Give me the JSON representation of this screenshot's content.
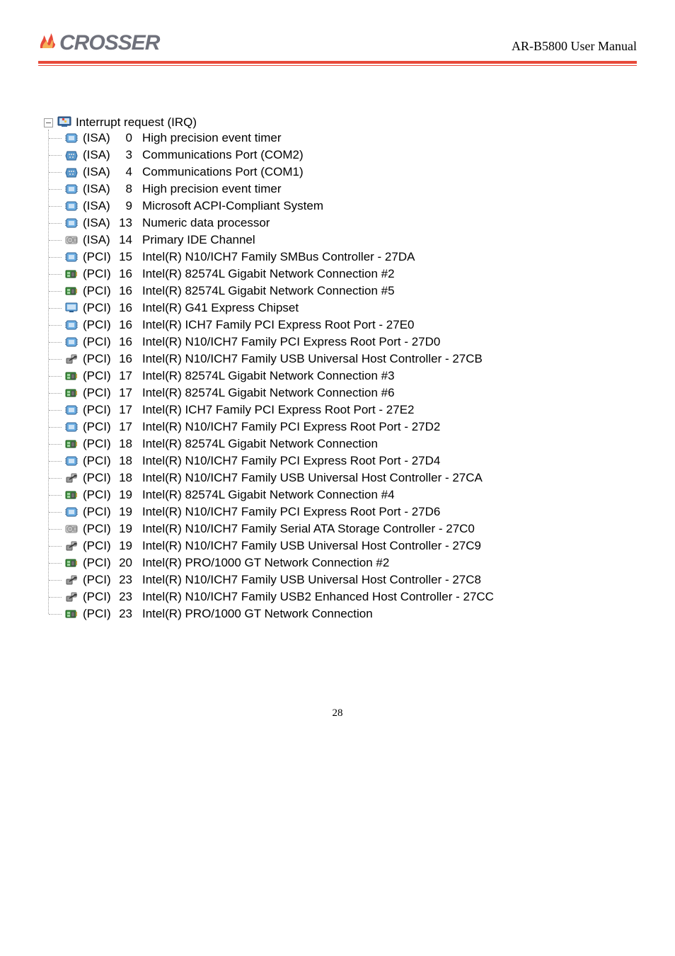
{
  "header": {
    "logo_main": "CROSSER",
    "doc_title": "AR-B5800 User Manual"
  },
  "tree": {
    "root_label": "Interrupt request (IRQ)",
    "items": [
      {
        "icon": "chip",
        "bus": "(ISA)",
        "irq": "0",
        "desc": "High precision event timer"
      },
      {
        "icon": "port",
        "bus": "(ISA)",
        "irq": "3",
        "desc": "Communications Port (COM2)"
      },
      {
        "icon": "port",
        "bus": "(ISA)",
        "irq": "4",
        "desc": "Communications Port (COM1)"
      },
      {
        "icon": "chip",
        "bus": "(ISA)",
        "irq": "8",
        "desc": "High precision event timer"
      },
      {
        "icon": "chip",
        "bus": "(ISA)",
        "irq": "9",
        "desc": "Microsoft ACPI-Compliant System"
      },
      {
        "icon": "chip",
        "bus": "(ISA)",
        "irq": "13",
        "desc": "Numeric data processor"
      },
      {
        "icon": "disk",
        "bus": "(ISA)",
        "irq": "14",
        "desc": "Primary IDE Channel"
      },
      {
        "icon": "chip",
        "bus": "(PCI)",
        "irq": "15",
        "desc": "Intel(R) N10/ICH7 Family SMBus Controller - 27DA"
      },
      {
        "icon": "nic",
        "bus": "(PCI)",
        "irq": "16",
        "desc": "Intel(R) 82574L Gigabit Network Connection #2"
      },
      {
        "icon": "nic",
        "bus": "(PCI)",
        "irq": "16",
        "desc": "Intel(R) 82574L Gigabit Network Connection #5"
      },
      {
        "icon": "display",
        "bus": "(PCI)",
        "irq": "16",
        "desc": "Intel(R) G41 Express Chipset"
      },
      {
        "icon": "chip",
        "bus": "(PCI)",
        "irq": "16",
        "desc": "Intel(R) ICH7 Family PCI Express Root Port - 27E0"
      },
      {
        "icon": "chip",
        "bus": "(PCI)",
        "irq": "16",
        "desc": "Intel(R) N10/ICH7 Family PCI Express Root Port - 27D0"
      },
      {
        "icon": "usb",
        "bus": "(PCI)",
        "irq": "16",
        "desc": "Intel(R) N10/ICH7 Family USB Universal Host Controller - 27CB"
      },
      {
        "icon": "nic",
        "bus": "(PCI)",
        "irq": "17",
        "desc": "Intel(R) 82574L Gigabit Network Connection #3"
      },
      {
        "icon": "nic",
        "bus": "(PCI)",
        "irq": "17",
        "desc": "Intel(R) 82574L Gigabit Network Connection #6"
      },
      {
        "icon": "chip",
        "bus": "(PCI)",
        "irq": "17",
        "desc": "Intel(R) ICH7 Family PCI Express Root Port - 27E2"
      },
      {
        "icon": "chip",
        "bus": "(PCI)",
        "irq": "17",
        "desc": "Intel(R) N10/ICH7 Family PCI Express Root Port - 27D2"
      },
      {
        "icon": "nic",
        "bus": "(PCI)",
        "irq": "18",
        "desc": "Intel(R) 82574L Gigabit Network Connection"
      },
      {
        "icon": "chip",
        "bus": "(PCI)",
        "irq": "18",
        "desc": "Intel(R) N10/ICH7 Family PCI Express Root Port - 27D4"
      },
      {
        "icon": "usb",
        "bus": "(PCI)",
        "irq": "18",
        "desc": "Intel(R) N10/ICH7 Family USB Universal Host Controller - 27CA"
      },
      {
        "icon": "nic",
        "bus": "(PCI)",
        "irq": "19",
        "desc": "Intel(R) 82574L Gigabit Network Connection #4"
      },
      {
        "icon": "chip",
        "bus": "(PCI)",
        "irq": "19",
        "desc": "Intel(R) N10/ICH7 Family PCI Express Root Port - 27D6"
      },
      {
        "icon": "disk",
        "bus": "(PCI)",
        "irq": "19",
        "desc": "Intel(R) N10/ICH7 Family Serial ATA Storage Controller - 27C0"
      },
      {
        "icon": "usb",
        "bus": "(PCI)",
        "irq": "19",
        "desc": "Intel(R) N10/ICH7 Family USB Universal Host Controller - 27C9"
      },
      {
        "icon": "nic",
        "bus": "(PCI)",
        "irq": "20",
        "desc": "Intel(R) PRO/1000 GT Network Connection #2"
      },
      {
        "icon": "usb",
        "bus": "(PCI)",
        "irq": "23",
        "desc": "Intel(R) N10/ICH7 Family USB Universal Host Controller - 27C8"
      },
      {
        "icon": "usb",
        "bus": "(PCI)",
        "irq": "23",
        "desc": "Intel(R) N10/ICH7 Family USB2 Enhanced Host Controller - 27CC"
      },
      {
        "icon": "nic",
        "bus": "(PCI)",
        "irq": "23",
        "desc": "Intel(R) PRO/1000 GT Network Connection"
      }
    ]
  },
  "footer": {
    "page": "28"
  }
}
